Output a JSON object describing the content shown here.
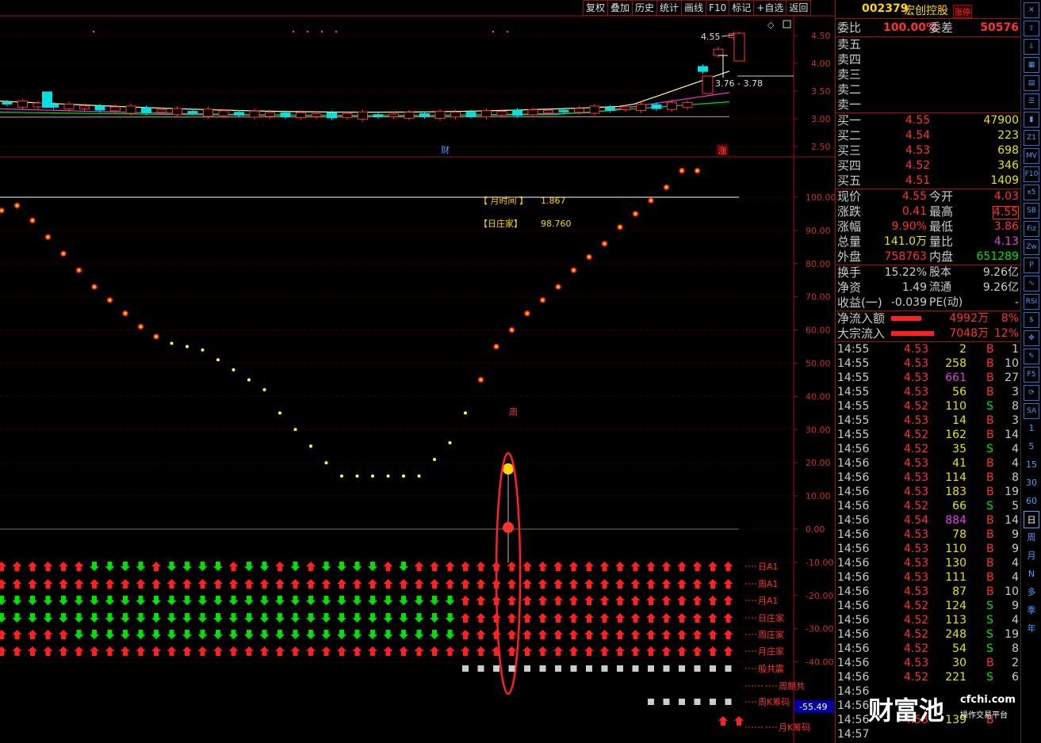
{
  "toolbar": [
    "复权",
    "叠加",
    "历史",
    "统计",
    "画线",
    "F10",
    "标记",
    "+自选",
    "返回"
  ],
  "stock": {
    "code": "002379",
    "name": "宏创控股",
    "badge": "涨停"
  },
  "wei": {
    "l1": "委比",
    "v1": "100.00%",
    "l2": "委差",
    "v2": "50576"
  },
  "sell": [
    "卖五",
    "卖四",
    "卖三",
    "卖二",
    "卖一"
  ],
  "buy": [
    {
      "label": "买一",
      "price": "4.55",
      "vol": "47900"
    },
    {
      "label": "买二",
      "price": "4.54",
      "vol": "223"
    },
    {
      "label": "买三",
      "price": "4.53",
      "vol": "698"
    },
    {
      "label": "买四",
      "price": "4.52",
      "vol": "346"
    },
    {
      "label": "买五",
      "price": "4.51",
      "vol": "1409"
    }
  ],
  "quote": [
    {
      "l1": "现价",
      "v1": "4.55",
      "c1": "r",
      "l2": "今开",
      "v2": "4.03",
      "c2": "r"
    },
    {
      "l1": "涨跌",
      "v1": "0.41",
      "c1": "r",
      "l2": "最高",
      "v2": "4.55",
      "c2": "r"
    },
    {
      "l1": "涨幅",
      "v1": "9.90%",
      "c1": "r",
      "l2": "最低",
      "v2": "3.86",
      "c2": "r"
    },
    {
      "l1": "总量",
      "v1": "141.0万",
      "c1": "y",
      "l2": "量比",
      "v2": "4.13",
      "c2": "m"
    },
    {
      "l1": "外盘",
      "v1": "758763",
      "c1": "r",
      "l2": "内盘",
      "v2": "651289",
      "c2": "g"
    }
  ],
  "stats": [
    {
      "l1": "换手",
      "v1": "15.22%",
      "l2": "股本",
      "v2": "9.26亿"
    },
    {
      "l1": "净资",
      "v1": "1.49",
      "l2": "流通",
      "v2": "9.26亿"
    },
    {
      "l1": "收益(一)",
      "v1": "-0.039",
      "l2": "PE(动)",
      "v2": "-"
    }
  ],
  "flow": [
    {
      "label": "净流入额",
      "amount": "4992万",
      "pct": "8%"
    },
    {
      "label": "大宗流入",
      "amount": "7048万",
      "pct": "12%"
    }
  ],
  "ticks": [
    [
      "14:55",
      "4.53",
      "2",
      "B",
      "1"
    ],
    [
      "14:55",
      "4.53",
      "258",
      "B",
      "10"
    ],
    [
      "14:55",
      "4.53",
      "661",
      "B",
      "27"
    ],
    [
      "14:55",
      "4.53",
      "56",
      "B",
      "3"
    ],
    [
      "14:55",
      "4.52",
      "110",
      "S",
      "8"
    ],
    [
      "14:55",
      "4.53",
      "14",
      "B",
      "3"
    ],
    [
      "14:55",
      "4.52",
      "162",
      "B",
      "14"
    ],
    [
      "14:56",
      "4.52",
      "35",
      "S",
      "4"
    ],
    [
      "14:56",
      "4.53",
      "41",
      "B",
      "4"
    ],
    [
      "14:56",
      "4.53",
      "114",
      "B",
      "8"
    ],
    [
      "14:56",
      "4.53",
      "183",
      "B",
      "19"
    ],
    [
      "14:56",
      "4.52",
      "66",
      "S",
      "5"
    ],
    [
      "14:56",
      "4.54",
      "884",
      "B",
      "14"
    ],
    [
      "14:56",
      "4.53",
      "78",
      "B",
      "9"
    ],
    [
      "14:56",
      "4.53",
      "110",
      "B",
      "9"
    ],
    [
      "14:56",
      "4.53",
      "130",
      "B",
      "4"
    ],
    [
      "14:56",
      "4.53",
      "111",
      "B",
      "4"
    ],
    [
      "14:56",
      "4.53",
      "87",
      "B",
      "10"
    ],
    [
      "14:56",
      "4.52",
      "124",
      "S",
      "9"
    ],
    [
      "14:56",
      "4.52",
      "113",
      "S",
      "4"
    ],
    [
      "14:56",
      "4.52",
      "248",
      "S",
      "19"
    ],
    [
      "14:56",
      "4.52",
      "54",
      "S",
      "8"
    ],
    [
      "14:56",
      "4.53",
      "30",
      "B",
      "2"
    ],
    [
      "14:56",
      "4.52",
      "221",
      "S",
      "6"
    ],
    [
      "14:56",
      "",
      "",
      "",
      ""
    ],
    [
      "14:56",
      "",
      "",
      "",
      ""
    ],
    [
      "14:56",
      "4.53",
      "139",
      "B",
      ""
    ],
    [
      "14:57",
      "",
      "",
      "",
      ""
    ]
  ],
  "price_axis": [
    "4.50",
    "4.00",
    "3.50",
    "3.00",
    "2.50"
  ],
  "ind_axis": [
    "100.00",
    "90.00",
    "80.00",
    "70.00",
    "60.00",
    "50.00",
    "40.00",
    "30.00",
    "20.00",
    "10.00",
    "0.00",
    "-10.00",
    "-20.00",
    "-30.00",
    "-40.00"
  ],
  "annot": {
    "hi": "4.55",
    "lo": "3.76 - 3.78",
    "cai": "财",
    "zhang": "涨",
    "zhou": "周"
  },
  "legend": {
    "l1": "【 月时间 】",
    "v1": "1.867",
    "l2": "【日庄家】",
    "v2": "98.760"
  },
  "bottom_value": "-55.49",
  "row_labels": [
    "日A1",
    "周A1",
    "月A1",
    "日庄家",
    "周庄家",
    "月庄家",
    "般共震",
    "周期共",
    "周K筹码",
    "月K筹码"
  ],
  "icons": {
    "z1": "Z1",
    "mv": "MV",
    "x5": "x5",
    "sb": "SB",
    "sa": "SA",
    "f10": "F10",
    "p": "P",
    "fiz": "Fiz",
    "zw": "Zw",
    "rsi": "RSI",
    "f5": "F5"
  },
  "periods": [
    "1",
    "5",
    "15",
    "30",
    "60",
    "日",
    "周",
    "月",
    "N",
    "多",
    "季",
    "年"
  ],
  "watermark": {
    "brand": "财富池",
    "site": "cfchi.com",
    "slogan": "操作交易平台"
  },
  "chart_data": {
    "type": "line",
    "xlabel": "",
    "ylabel": "",
    "price_ylim": [
      2.4,
      4.65
    ],
    "indicator_ylim": [
      -40,
      108
    ],
    "indicator_series": {
      "values": [
        96,
        97.5,
        93,
        88,
        83,
        78,
        73,
        69,
        65,
        61,
        58,
        56,
        55,
        54,
        51,
        48,
        45,
        42,
        35,
        30,
        25,
        20,
        16,
        16,
        16,
        16,
        16,
        16,
        21,
        26,
        35,
        45,
        55,
        60,
        65,
        69,
        73,
        78,
        82,
        86,
        91,
        95,
        99,
        103,
        108,
        108
      ]
    }
  }
}
